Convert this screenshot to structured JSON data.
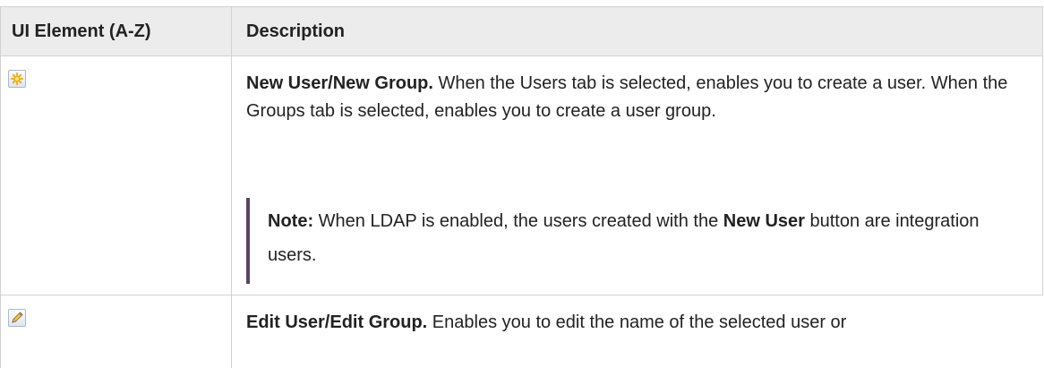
{
  "table": {
    "headers": [
      "UI Element (A-Z)",
      "Description"
    ],
    "rows": [
      {
        "icon": "new-icon",
        "title": "New User/New Group.",
        "text": " When the Users tab is selected, enables you to create a user. When the Groups tab is selected, enables you to create a user group.",
        "note": {
          "label": "Note:",
          "text_before": "  When LDAP is enabled, the users created with the ",
          "bold": "New User",
          "text_after": " button are integration users."
        }
      },
      {
        "icon": "edit-pencil-icon",
        "title": "Edit User/Edit Group.",
        "text": " Enables you to edit the name of the selected user or"
      }
    ]
  },
  "colors": {
    "header_bg": "#ececec",
    "border": "#d2d2d2",
    "note_bar": "#5a4561",
    "icon_new": "#f2b31a",
    "icon_edit": "#e4a020"
  }
}
